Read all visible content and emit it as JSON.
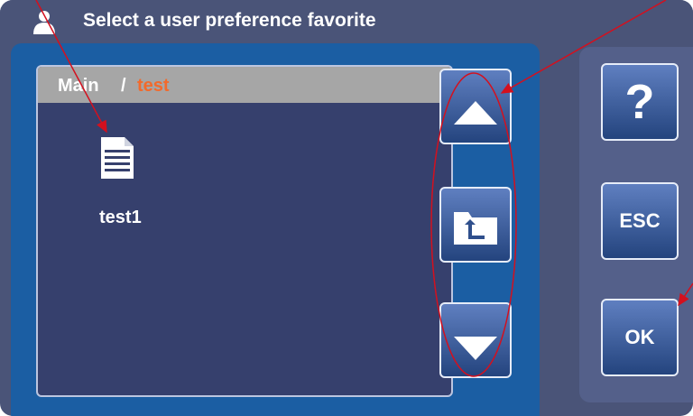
{
  "titlebar": {
    "title": "Select a user preference favorite",
    "icon": "user-icon"
  },
  "browser": {
    "path_root": "Main",
    "path_separator": "/",
    "path_current": "test",
    "items": [
      {
        "label": "test1",
        "icon": "document-icon"
      }
    ]
  },
  "nav_buttons": {
    "up_icon": "arrow-up-icon",
    "parent_icon": "folder-up-icon",
    "down_icon": "arrow-down-icon"
  },
  "side_buttons": {
    "help_label": "?",
    "esc_label": "ESC",
    "ok_label": "OK"
  },
  "colors": {
    "accent": "#f26a2c",
    "panel_blue": "#1b5ea3",
    "annotation_red": "#d4101e"
  }
}
